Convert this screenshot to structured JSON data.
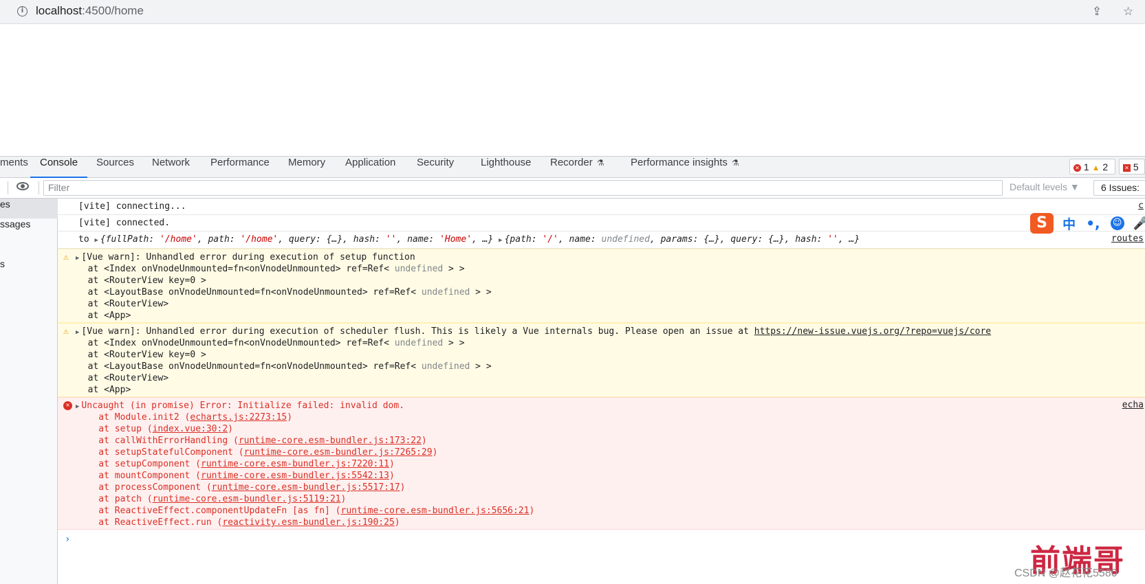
{
  "browser": {
    "url_host": "localhost",
    "url_rest": ":4500/home"
  },
  "devtools": {
    "tabs": [
      "ments",
      "Console",
      "Sources",
      "Network",
      "Performance",
      "Memory",
      "Application",
      "Security",
      "Lighthouse",
      "Recorder",
      "Performance insights"
    ],
    "badges": {
      "errors": "1",
      "warnings": "2",
      "issues": "5"
    },
    "filter_placeholder": "Filter",
    "levels": "Default levels ▼",
    "issues_button": "6 Issues:",
    "sidebar": [
      "es",
      "ssages",
      "s"
    ]
  },
  "console": {
    "vite1": "[vite] connecting...",
    "vite1_src": "c",
    "vite2": "[vite] connected.",
    "to_line": {
      "prefix": "to ",
      "obj1_a": "{",
      "obj1_k1": "fullPath: ",
      "obj1_v1": "'/home'",
      "obj1_k2": ", path: ",
      "obj1_v2": "'/home'",
      "obj1_k3": ", query: {…}, hash: ",
      "obj1_v3": "''",
      "obj1_k4": ", name: ",
      "obj1_v4": "'Home'",
      "obj1_end": ", …}",
      "obj2_a": "{",
      "obj2_k1": "path: ",
      "obj2_v1": "'/'",
      "obj2_k2": ", name: ",
      "obj2_v2": "undefined",
      "obj2_k3": ", params: {…}, query: {…}, hash: ",
      "obj2_v3": "''",
      "obj2_end": ", …}",
      "src": "routes"
    },
    "warn1": {
      "title": "[Vue warn]: Unhandled error during execution of setup function",
      "l1a": "  at <Index onVnodeUnmounted=fn<onVnodeUnmounted> ref=Ref< ",
      "l1b": "undefined",
      "l1c": " > >",
      "l2": "  at <RouterView key=0 >",
      "l3a": "  at <LayoutBase onVnodeUnmounted=fn<onVnodeUnmounted> ref=Ref< ",
      "l3b": "undefined",
      "l3c": " > >",
      "l4": "  at <RouterView>",
      "l5": "  at <App>"
    },
    "warn2": {
      "title": "[Vue warn]: Unhandled error during execution of scheduler flush. This is likely a Vue internals bug. Please open an issue at ",
      "link": "https://new-issue.vuejs.org/?repo=vuejs/core",
      "l1a": "  at <Index onVnodeUnmounted=fn<onVnodeUnmounted> ref=Ref< ",
      "l1b": "undefined",
      "l1c": " > >",
      "l2": "  at <RouterView key=0 >",
      "l3a": "  at <LayoutBase onVnodeUnmounted=fn<onVnodeUnmounted> ref=Ref< ",
      "l3b": "undefined",
      "l3c": " > >",
      "l4": "  at <RouterView>",
      "l5": "  at <App>"
    },
    "error": {
      "title": "Uncaught (in promise) Error: Initialize failed: invalid dom.",
      "src": "echa",
      "stack": [
        {
          "fn": "    at Module.init2 (",
          "loc": "echarts.js:2273:15",
          "end": ")"
        },
        {
          "fn": "    at setup (",
          "loc": "index.vue:30:2",
          "end": ")"
        },
        {
          "fn": "    at callWithErrorHandling (",
          "loc": "runtime-core.esm-bundler.js:173:22",
          "end": ")"
        },
        {
          "fn": "    at setupStatefulComponent (",
          "loc": "runtime-core.esm-bundler.js:7265:29",
          "end": ")"
        },
        {
          "fn": "    at setupComponent (",
          "loc": "runtime-core.esm-bundler.js:7220:11",
          "end": ")"
        },
        {
          "fn": "    at mountComponent (",
          "loc": "runtime-core.esm-bundler.js:5542:13",
          "end": ")"
        },
        {
          "fn": "    at processComponent (",
          "loc": "runtime-core.esm-bundler.js:5517:17",
          "end": ")"
        },
        {
          "fn": "    at patch (",
          "loc": "runtime-core.esm-bundler.js:5119:21",
          "end": ")"
        },
        {
          "fn": "    at ReactiveEffect.componentUpdateFn [as fn] (",
          "loc": "runtime-core.esm-bundler.js:5656:21",
          "end": ")"
        },
        {
          "fn": "    at ReactiveEffect.run (",
          "loc": "reactivity.esm-bundler.js:190:25",
          "end": ")"
        }
      ]
    },
    "prompt": "›"
  },
  "ime": {
    "logo": "S",
    "lang": "中",
    "punct": "•,",
    "face": "☺",
    "mic": "🎤"
  },
  "watermark": {
    "brand": "前端哥",
    "csdn": "CSDN @赵花花5580"
  },
  "colors": {
    "accent": "#1a73e8",
    "error": "#d93025",
    "warning": "#e8a600"
  }
}
